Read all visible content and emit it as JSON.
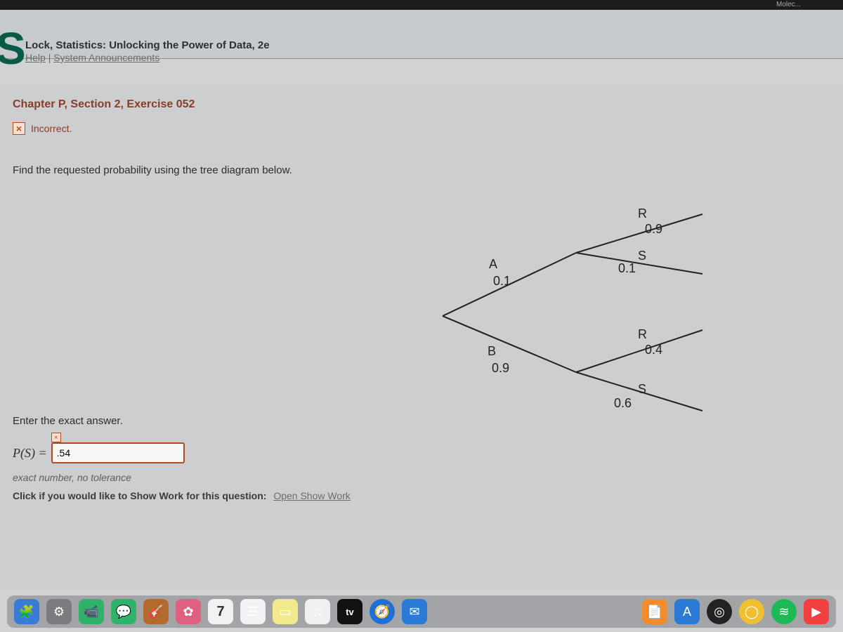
{
  "topbar": {
    "fragment": "Molec..."
  },
  "header": {
    "site_letter": "S",
    "book_title": "Lock, Statistics: Unlocking the Power of Data, 2e",
    "link_help": "Help",
    "link_sep": " | ",
    "link_announcements": "System Announcements"
  },
  "main": {
    "chapter": "Chapter P, Section 2, Exercise 052",
    "feedback_icon": "×",
    "feedback_text": "Incorrect.",
    "instruction": "Find the requested probability using the tree diagram below.",
    "enter_label": "Enter the exact answer.",
    "answer_prefix": "P(S) =",
    "answer_value": ".54",
    "mini_x": "×",
    "tolerance": "exact number, no tolerance",
    "show_work_prefix": "Click if you would like to Show Work for this question:",
    "show_work_link": "Open Show Work"
  },
  "tree": {
    "first": [
      {
        "label": "A",
        "p": "0.1"
      },
      {
        "label": "B",
        "p": "0.9"
      }
    ],
    "secondA": [
      {
        "label": "R",
        "p": "0.9"
      },
      {
        "label": "S",
        "p": "0.1"
      }
    ],
    "secondB": [
      {
        "label": "R",
        "p": "0.4"
      },
      {
        "label": "S",
        "p": "0.6"
      }
    ]
  },
  "chart_data": {
    "type": "table",
    "title": "Probability tree",
    "series": [
      {
        "name": "A",
        "values": [
          0.1
        ],
        "children": [
          {
            "name": "R",
            "values": [
              0.9
            ]
          },
          {
            "name": "S",
            "values": [
              0.1
            ]
          }
        ]
      },
      {
        "name": "B",
        "values": [
          0.9
        ],
        "children": [
          {
            "name": "R",
            "values": [
              0.4
            ]
          },
          {
            "name": "S",
            "values": [
              0.6
            ]
          }
        ]
      }
    ]
  },
  "dock": {
    "items": [
      {
        "name": "finder-icon",
        "glyph": "🧩",
        "bg": "#3a7bd5"
      },
      {
        "name": "system-prefs-icon",
        "glyph": "⚙",
        "bg": "#7a7c80"
      },
      {
        "name": "facetime-icon",
        "glyph": "📹",
        "bg": "#2fb36a"
      },
      {
        "name": "messages-icon",
        "glyph": "💬",
        "bg": "#2fb36a"
      },
      {
        "name": "garageband-icon",
        "glyph": "🎸",
        "bg": "#b36a2f"
      },
      {
        "name": "photos-icon",
        "glyph": "✿",
        "bg": "#e06080"
      },
      {
        "name": "calendar-icon",
        "glyph": "7",
        "bg": "#f2f2f2"
      },
      {
        "name": "reminders-icon",
        "glyph": "☰",
        "bg": "#f2f2f2"
      },
      {
        "name": "notes-icon",
        "glyph": "▭",
        "bg": "#f2e98c"
      },
      {
        "name": "music-icon",
        "glyph": "♫",
        "bg": "#f0f0f0"
      },
      {
        "name": "appletv-icon",
        "glyph": "tv",
        "bg": "#111"
      },
      {
        "name": "safari-icon",
        "glyph": "🧭",
        "bg": "#1e6fd6"
      },
      {
        "name": "mail-icon",
        "glyph": "✉",
        "bg": "#2a7ad6"
      },
      {
        "name": "pages-icon",
        "glyph": "📄",
        "bg": "#f28c2f"
      },
      {
        "name": "appstore-icon",
        "glyph": "A",
        "bg": "#2a7ad6"
      },
      {
        "name": "siri-icon",
        "glyph": "◎",
        "bg": "#222"
      },
      {
        "name": "chrome-icon",
        "glyph": "◯",
        "bg": "#f0c030"
      },
      {
        "name": "spotify-icon",
        "glyph": "≋",
        "bg": "#1db954"
      },
      {
        "name": "youtube-icon",
        "glyph": "▶",
        "bg": "#f04040"
      }
    ],
    "tv_label": "tv"
  }
}
